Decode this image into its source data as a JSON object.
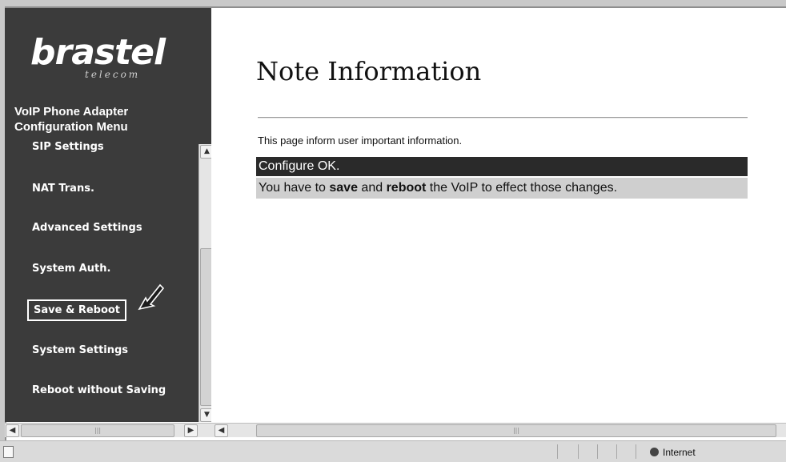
{
  "brand": {
    "name": "brastel",
    "sub": "telecom"
  },
  "menu": {
    "title_line1": "VoIP Phone Adapter",
    "title_line2": "Configuration Menu",
    "items": [
      {
        "label": "SIP Settings"
      },
      {
        "label": "NAT Trans."
      },
      {
        "label": "Advanced Settings"
      },
      {
        "label": "System Auth."
      },
      {
        "label": "Save & Reboot",
        "highlighted": true
      },
      {
        "label": "System Settings"
      },
      {
        "label": "Reboot without Saving"
      }
    ]
  },
  "page": {
    "title": "Note Information",
    "description": "This page inform user important information.",
    "status": "Configure OK.",
    "notice": {
      "part1": "You have to ",
      "bold1": "save",
      "part2": " and ",
      "bold2": "reboot",
      "part3": " the VoIP to effect those changes."
    }
  },
  "statusbar": {
    "zone": "Internet"
  },
  "icons": [
    "brastel-logo",
    "pointer-arrow-icon",
    "scroll-up-icon",
    "scroll-down-icon",
    "scroll-left-icon",
    "scroll-right-icon",
    "page-icon",
    "globe-icon"
  ]
}
